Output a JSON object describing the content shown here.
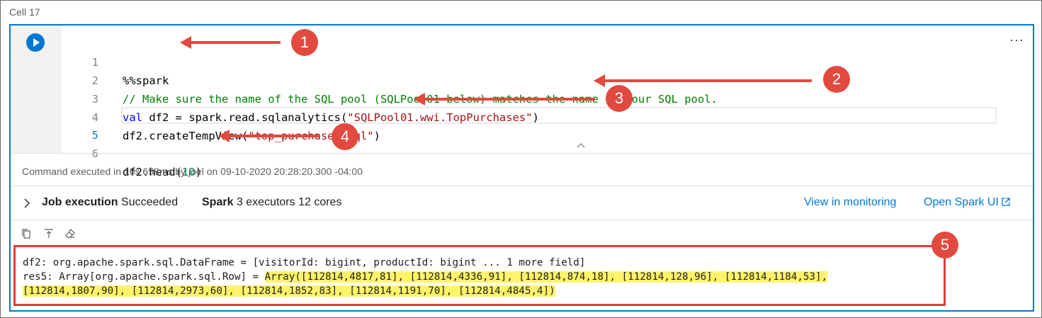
{
  "cell": {
    "label": "Cell 17",
    "more_label": "···"
  },
  "code": {
    "lines": [
      {
        "num": "1",
        "text": "%%spark"
      },
      {
        "num": "2",
        "comment": "// Make sure the name of the SQL pool (SQLPool01 below) matches the name of your SQL pool."
      },
      {
        "num": "3",
        "kw": "val",
        "pre": " df2 = spark.read.sqlanalytics(",
        "str": "\"SQLPool01.wwi.TopPurchases\"",
        "post": ")"
      },
      {
        "num": "4",
        "pre": "df2.createTempView(",
        "str": "\"top_purchases_sql\"",
        "post": ")"
      },
      {
        "num": "5",
        "text": ""
      },
      {
        "num": "6",
        "pre": "df2.head(",
        "numlit": "10",
        "post": ")"
      }
    ]
  },
  "status": {
    "text": "Command executed in 10s 658ms by joel on 09-10-2020 20:28:20.300 -04:00"
  },
  "job": {
    "label": "Job execution",
    "state": "Succeeded",
    "spark_label": "Spark",
    "spark_info": "3 executors 12 cores",
    "view_link": "View in monitoring",
    "spark_ui_link": "Open Spark UI"
  },
  "output": {
    "line1": "df2: org.apache.spark.sql.DataFrame = [visitorId: bigint, productId: bigint ... 1 more field]",
    "line2_prefix": "res5: Array[org.apache.spark.sql.Row] = ",
    "line2_highlight": "Array([112814,4817,81], [112814,4336,91], [112814,874,18], [112814,128,96], [112814,1184,53],",
    "line3_highlight": "[112814,1807,90], [112814,2973,60], [112814,1852,83], [112814,1191,70], [112814,4845,4])"
  },
  "callouts": [
    "1",
    "2",
    "3",
    "4",
    "5"
  ],
  "colors": {
    "accent": "#0078d4",
    "callout": "#e24a3f",
    "highlight": "#fff36b"
  }
}
